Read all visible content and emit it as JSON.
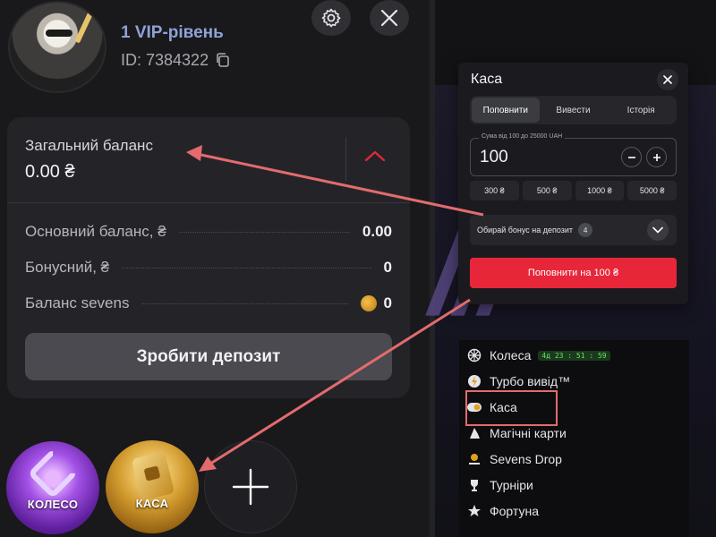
{
  "profile": {
    "vip_level": "1 VIP-рівень",
    "user_id": "ID: 7384322"
  },
  "balance": {
    "total_label": "Загальний баланс",
    "total_value": "0.00 ₴",
    "rows": [
      {
        "label": "Основний баланс, ₴",
        "value": "0.00"
      },
      {
        "label": "Бонусний, ₴",
        "value": "0"
      },
      {
        "label": "Баланс sevens",
        "value": "0"
      }
    ],
    "deposit_button": "Зробити депозит"
  },
  "widgets": {
    "wheel_label": "КОЛЕСО",
    "cash_label": "КАСА"
  },
  "cash_popup": {
    "title": "Каса",
    "tabs": [
      "Поповнити",
      "Вивести",
      "Історія"
    ],
    "active_tab": "Поповнити",
    "amount_hint": "Сума від 100 до 25000 UAH",
    "amount_value": "100",
    "presets": [
      "300 ₴",
      "500 ₴",
      "1000 ₴",
      "5000 ₴"
    ],
    "bonus_label": "Обирай бонус на депозит",
    "bonus_count": "4",
    "topup_button": "Поповнити на 100 ₴"
  },
  "menu": {
    "items": [
      {
        "label": "Колеса",
        "icon": "wheel-icon",
        "timer": "4д 23 : 51 : 59"
      },
      {
        "label": "Турбо вивід™",
        "icon": "lightning-icon"
      },
      {
        "label": "Каса",
        "icon": "cash-toggle-icon"
      },
      {
        "label": "Магічні карти",
        "icon": "wizard-hat-icon"
      },
      {
        "label": "Sevens Drop",
        "icon": "coin-hand-icon"
      },
      {
        "label": "Турніри",
        "icon": "trophy-icon"
      },
      {
        "label": "Фортуна",
        "icon": "star-icon"
      }
    ]
  },
  "colors": {
    "accent_red": "#e8263a",
    "vip_text": "#8fa2d8",
    "annotation": "#e36b6e"
  }
}
